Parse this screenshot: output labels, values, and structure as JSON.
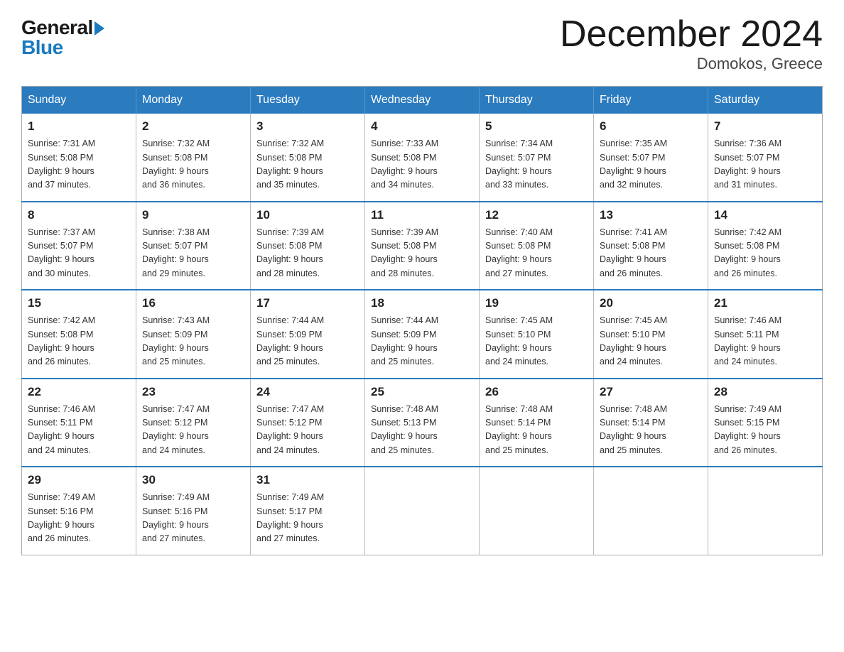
{
  "logo": {
    "general": "General",
    "blue": "Blue"
  },
  "title": {
    "month_year": "December 2024",
    "location": "Domokos, Greece"
  },
  "headers": [
    "Sunday",
    "Monday",
    "Tuesday",
    "Wednesday",
    "Thursday",
    "Friday",
    "Saturday"
  ],
  "weeks": [
    [
      {
        "day": "1",
        "sunrise": "7:31 AM",
        "sunset": "5:08 PM",
        "daylight": "9 hours and 37 minutes."
      },
      {
        "day": "2",
        "sunrise": "7:32 AM",
        "sunset": "5:08 PM",
        "daylight": "9 hours and 36 minutes."
      },
      {
        "day": "3",
        "sunrise": "7:32 AM",
        "sunset": "5:08 PM",
        "daylight": "9 hours and 35 minutes."
      },
      {
        "day": "4",
        "sunrise": "7:33 AM",
        "sunset": "5:08 PM",
        "daylight": "9 hours and 34 minutes."
      },
      {
        "day": "5",
        "sunrise": "7:34 AM",
        "sunset": "5:07 PM",
        "daylight": "9 hours and 33 minutes."
      },
      {
        "day": "6",
        "sunrise": "7:35 AM",
        "sunset": "5:07 PM",
        "daylight": "9 hours and 32 minutes."
      },
      {
        "day": "7",
        "sunrise": "7:36 AM",
        "sunset": "5:07 PM",
        "daylight": "9 hours and 31 minutes."
      }
    ],
    [
      {
        "day": "8",
        "sunrise": "7:37 AM",
        "sunset": "5:07 PM",
        "daylight": "9 hours and 30 minutes."
      },
      {
        "day": "9",
        "sunrise": "7:38 AM",
        "sunset": "5:07 PM",
        "daylight": "9 hours and 29 minutes."
      },
      {
        "day": "10",
        "sunrise": "7:39 AM",
        "sunset": "5:08 PM",
        "daylight": "9 hours and 28 minutes."
      },
      {
        "day": "11",
        "sunrise": "7:39 AM",
        "sunset": "5:08 PM",
        "daylight": "9 hours and 28 minutes."
      },
      {
        "day": "12",
        "sunrise": "7:40 AM",
        "sunset": "5:08 PM",
        "daylight": "9 hours and 27 minutes."
      },
      {
        "day": "13",
        "sunrise": "7:41 AM",
        "sunset": "5:08 PM",
        "daylight": "9 hours and 26 minutes."
      },
      {
        "day": "14",
        "sunrise": "7:42 AM",
        "sunset": "5:08 PM",
        "daylight": "9 hours and 26 minutes."
      }
    ],
    [
      {
        "day": "15",
        "sunrise": "7:42 AM",
        "sunset": "5:08 PM",
        "daylight": "9 hours and 26 minutes."
      },
      {
        "day": "16",
        "sunrise": "7:43 AM",
        "sunset": "5:09 PM",
        "daylight": "9 hours and 25 minutes."
      },
      {
        "day": "17",
        "sunrise": "7:44 AM",
        "sunset": "5:09 PM",
        "daylight": "9 hours and 25 minutes."
      },
      {
        "day": "18",
        "sunrise": "7:44 AM",
        "sunset": "5:09 PM",
        "daylight": "9 hours and 25 minutes."
      },
      {
        "day": "19",
        "sunrise": "7:45 AM",
        "sunset": "5:10 PM",
        "daylight": "9 hours and 24 minutes."
      },
      {
        "day": "20",
        "sunrise": "7:45 AM",
        "sunset": "5:10 PM",
        "daylight": "9 hours and 24 minutes."
      },
      {
        "day": "21",
        "sunrise": "7:46 AM",
        "sunset": "5:11 PM",
        "daylight": "9 hours and 24 minutes."
      }
    ],
    [
      {
        "day": "22",
        "sunrise": "7:46 AM",
        "sunset": "5:11 PM",
        "daylight": "9 hours and 24 minutes."
      },
      {
        "day": "23",
        "sunrise": "7:47 AM",
        "sunset": "5:12 PM",
        "daylight": "9 hours and 24 minutes."
      },
      {
        "day": "24",
        "sunrise": "7:47 AM",
        "sunset": "5:12 PM",
        "daylight": "9 hours and 24 minutes."
      },
      {
        "day": "25",
        "sunrise": "7:48 AM",
        "sunset": "5:13 PM",
        "daylight": "9 hours and 25 minutes."
      },
      {
        "day": "26",
        "sunrise": "7:48 AM",
        "sunset": "5:14 PM",
        "daylight": "9 hours and 25 minutes."
      },
      {
        "day": "27",
        "sunrise": "7:48 AM",
        "sunset": "5:14 PM",
        "daylight": "9 hours and 25 minutes."
      },
      {
        "day": "28",
        "sunrise": "7:49 AM",
        "sunset": "5:15 PM",
        "daylight": "9 hours and 26 minutes."
      }
    ],
    [
      {
        "day": "29",
        "sunrise": "7:49 AM",
        "sunset": "5:16 PM",
        "daylight": "9 hours and 26 minutes."
      },
      {
        "day": "30",
        "sunrise": "7:49 AM",
        "sunset": "5:16 PM",
        "daylight": "9 hours and 27 minutes."
      },
      {
        "day": "31",
        "sunrise": "7:49 AM",
        "sunset": "5:17 PM",
        "daylight": "9 hours and 27 minutes."
      },
      null,
      null,
      null,
      null
    ]
  ],
  "labels": {
    "sunrise": "Sunrise:",
    "sunset": "Sunset:",
    "daylight": "Daylight:"
  }
}
